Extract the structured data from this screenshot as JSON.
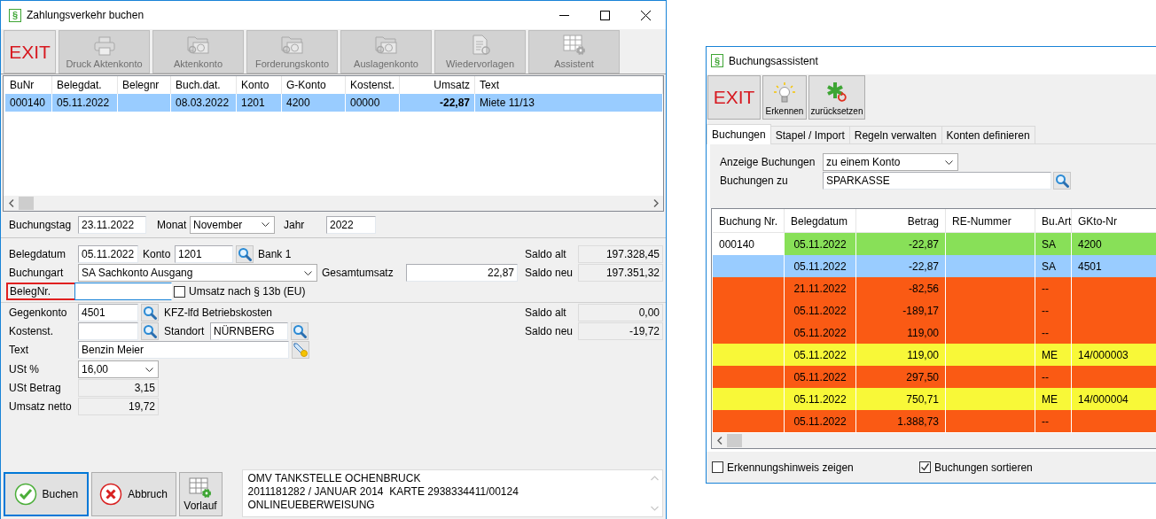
{
  "main_window": {
    "app_icon": "§",
    "title": "Zahlungsverkehr buchen",
    "toolbar": [
      {
        "label": "EXIT",
        "kind": "exit",
        "disabled": false
      },
      {
        "label": "Druck Aktenkonto",
        "kind": "printer",
        "disabled": true
      },
      {
        "label": "Aktenkonto",
        "kind": "folder",
        "disabled": true
      },
      {
        "label": "Forderungskonto",
        "kind": "folder",
        "disabled": true
      },
      {
        "label": "Auslagenkonto",
        "kind": "folder",
        "disabled": true
      },
      {
        "label": "Wiedervorlagen",
        "kind": "document",
        "disabled": true
      },
      {
        "label": "Assistent",
        "kind": "grid",
        "disabled": true
      }
    ],
    "table": {
      "columns": [
        "BuNr",
        "Belegdat.",
        "Belegnr",
        "Buch.dat.",
        "Konto",
        "G-Konto",
        "Kostenst.",
        "Umsatz",
        "Text"
      ],
      "rows": [
        {
          "bu_nr": "000140",
          "belegdat": "05.11.2022",
          "buchdat": "08.03.2022",
          "konto": "1201",
          "gkonto": "4200",
          "kostenst": "00000",
          "umsatz": "-22,87",
          "text": "Miete 11/13",
          "selected": true
        }
      ]
    },
    "booking_day": {
      "label": "Buchungstag",
      "value": "23.11.2022"
    },
    "month": {
      "label": "Monat",
      "value": "November"
    },
    "year": {
      "label": "Jahr",
      "value": "2022"
    },
    "form": {
      "belegdatum": {
        "label": "Belegdatum",
        "value": "05.11.2022"
      },
      "konto": {
        "label": "Konto",
        "value": "1201",
        "name": "Bank 1"
      },
      "buchungsart": {
        "label": "Buchungart",
        "value": "SA Sachkonto Ausgang"
      },
      "gesamtumsatz": {
        "label": "Gesamtumsatz",
        "value": "22,87"
      },
      "belegnr": {
        "label": "BelegNr.",
        "highlighted": true
      },
      "reverse_charge": {
        "label": "Umsatz nach § 13b (EU)",
        "checked": false
      },
      "gegenkonto": {
        "label": "Gegenkonto",
        "value": "4501",
        "name": "KFZ-lfd Betriebskosten"
      },
      "kostenstelle": {
        "label": "Kostenst."
      },
      "standort": {
        "label": "Standort",
        "value": "NÜRNBERG"
      },
      "text": {
        "label": "Text",
        "value": "Benzin Meier"
      },
      "ust_prozent": {
        "label": "USt %",
        "value": "16,00"
      },
      "ust_betrag": {
        "label": "USt Betrag",
        "value": "3,15"
      },
      "umsatz_netto": {
        "label": "Umsatz netto",
        "value": "19,72"
      }
    },
    "balances": [
      {
        "label": "Saldo alt",
        "value": "197.328,45"
      },
      {
        "label": "Saldo neu",
        "value": "197.351,32"
      },
      {
        "label": "Saldo alt",
        "value": "0,00"
      },
      {
        "label": "Saldo neu",
        "value": "-19,72"
      }
    ],
    "actions": [
      {
        "label": "Buchen",
        "kind": "ok",
        "focused": true
      },
      {
        "label": "Abbruch",
        "kind": "cancel",
        "focused": false
      },
      {
        "label": "Vorlauf",
        "kind": "grid",
        "focused": false
      }
    ],
    "memo": {
      "lines": [
        "OMV TANKSTELLE OCHENBRUCK",
        "2011181282 / JANUAR 2014  KARTE 2938334411/00124",
        "ONLINEUEBERWEISUNG"
      ]
    }
  },
  "assistant_window": {
    "app_icon": "§",
    "title": "Buchungsassistent",
    "toolbar": [
      {
        "label": "EXIT",
        "kind": "exit"
      },
      {
        "label": "Erkennen",
        "kind": "bulb"
      },
      {
        "label": "zurücksetzen",
        "kind": "reset"
      }
    ],
    "tabs": [
      {
        "label": "Buchungen",
        "selected": true
      },
      {
        "label": "Stapel / Import",
        "selected": false
      },
      {
        "label": "Regeln verwalten",
        "selected": false
      },
      {
        "label": "Konten definieren",
        "selected": false
      }
    ],
    "display_filter": {
      "label": "Anzeige Buchungen",
      "value": "zu einem Konto"
    },
    "account_filter": {
      "label": "Buchungen zu",
      "value": "SPARKASSE"
    },
    "table": {
      "columns": [
        "Buchung Nr.",
        "Belegdatum",
        "Betrag",
        "RE-Nummer",
        "Bu.Art",
        "GKto-Nr"
      ],
      "rows": [
        {
          "bu_nr": "000140",
          "date": "05.11.2022",
          "amount": "-22,87",
          "type": "SA",
          "account": "4200",
          "color": "#88e058"
        },
        {
          "date": "05.11.2022",
          "amount": "-22,87",
          "type": "SA",
          "account": "4501",
          "color": "#99ccff"
        },
        {
          "date": "21.11.2022",
          "amount": "-82,56",
          "type": "--",
          "color": "#fa5a14"
        },
        {
          "date": "05.11.2022",
          "amount": "-189,17",
          "type": "--",
          "color": "#fa5a14"
        },
        {
          "date": "05.11.2022",
          "amount": "119,00",
          "type": "--",
          "color": "#fa5a14"
        },
        {
          "date": "05.11.2022",
          "amount": "119,00",
          "type": "ME",
          "account": "14/000003",
          "color": "#f8f838"
        },
        {
          "date": "05.11.2022",
          "amount": "297,50",
          "type": "--",
          "color": "#fa5a14"
        },
        {
          "date": "05.11.2022",
          "amount": "750,71",
          "type": "ME",
          "account": "14/000004",
          "color": "#f8f838"
        },
        {
          "date": "05.11.2022",
          "amount": "1.388,73",
          "type": "--",
          "color": "#fa5a14"
        }
      ]
    },
    "options": [
      {
        "label": "Erkennungshinweis zeigen",
        "checked": false
      },
      {
        "label": "Buchungen sortieren",
        "checked": true
      }
    ]
  }
}
